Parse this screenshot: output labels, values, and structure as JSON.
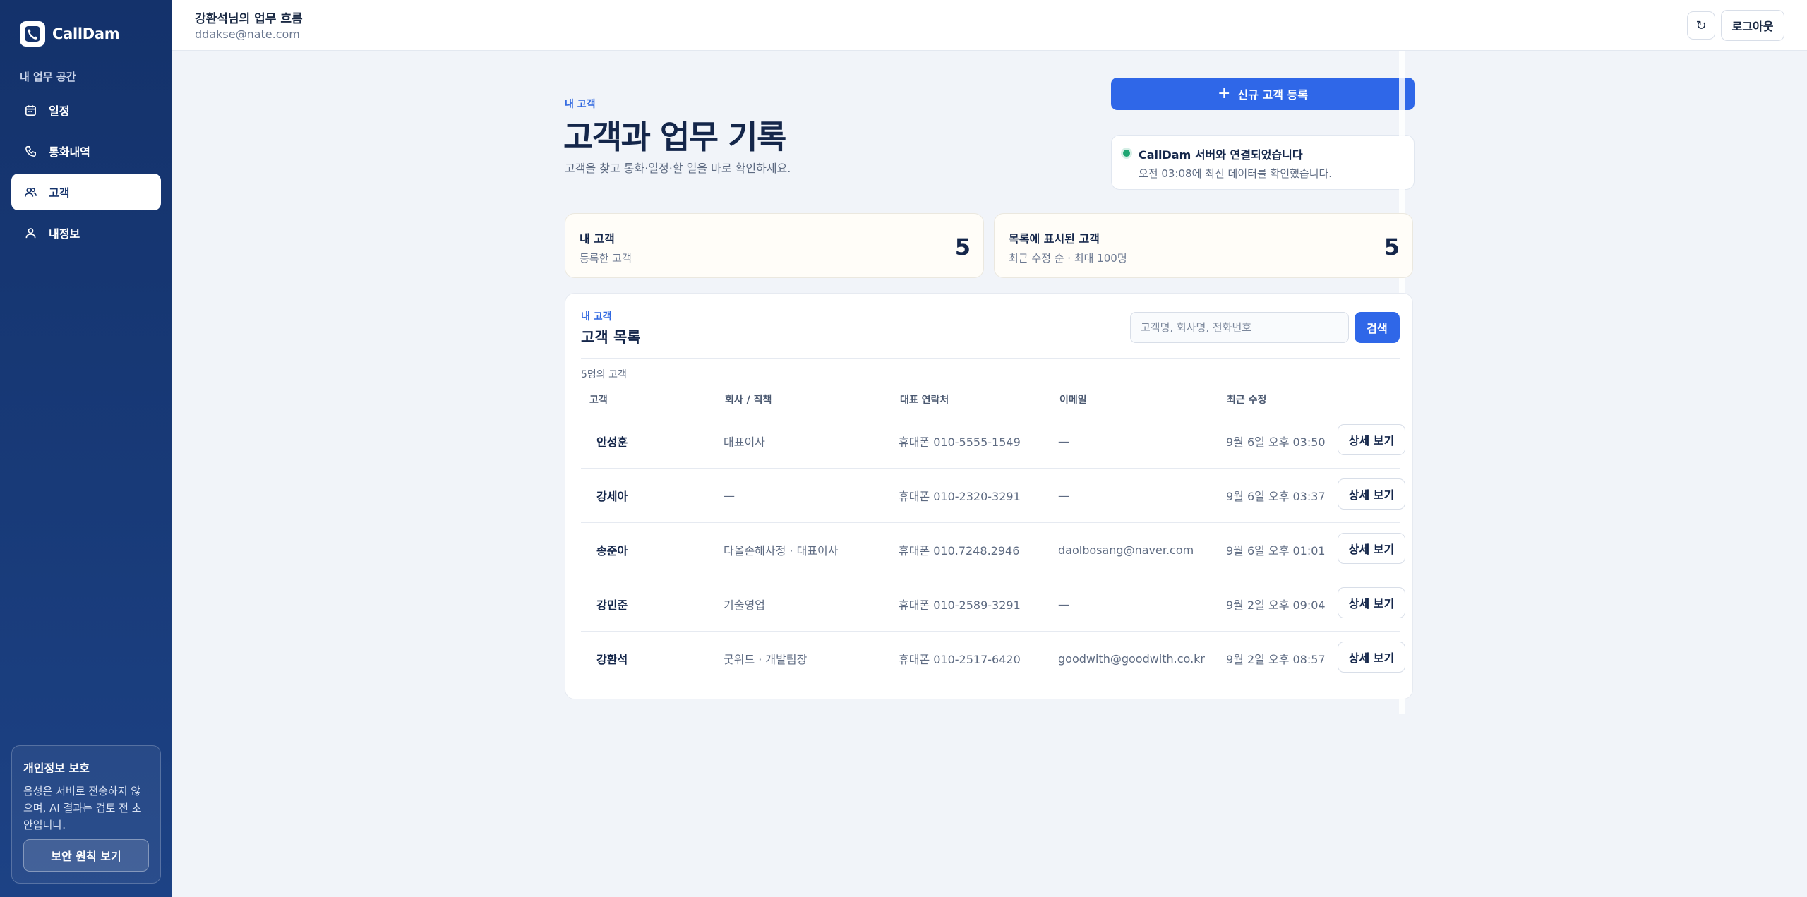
{
  "app": {
    "name": "CallDam"
  },
  "sidebar": {
    "section_label": "내 업무 공간",
    "items": [
      {
        "label": "일정",
        "icon": "calendar-icon",
        "active": false
      },
      {
        "label": "통화내역",
        "icon": "phone-icon",
        "active": false
      },
      {
        "label": "고객",
        "icon": "users-icon",
        "active": true
      },
      {
        "label": "내정보",
        "icon": "user-icon",
        "active": false
      }
    ],
    "privacy": {
      "title": "개인정보 보호",
      "text": "음성은 서버로 전송하지 않으며, AI 결과는 검토 전 초안입니다.",
      "button_label": "보안 원칙 보기"
    }
  },
  "header": {
    "title": "강환석님의 업무 흐름",
    "email": "ddakse@nate.com",
    "refresh_icon": "↻",
    "logout_label": "로그아웃"
  },
  "page": {
    "eyebrow": "내 고객",
    "title": "고객과 업무 기록",
    "subtitle": "고객을 찾고 통화·일정·할 일을 바로 확인하세요.",
    "new_button_label": "신규 고객 등록",
    "connection": {
      "title": "CallDam 서버와 연결되었습니다",
      "text": "오전 03:08에 최신 데이터를 확인했습니다."
    }
  },
  "stats": [
    {
      "label": "내 고객",
      "sub": "등록한 고객",
      "value": "5"
    },
    {
      "label": "목록에 표시된 고객",
      "sub": "최근 수정 순 · 최대 100명",
      "value": "5"
    }
  ],
  "customers": {
    "eyebrow": "내 고객",
    "title": "고객 목록",
    "search_placeholder": "고객명, 회사명, 전화번호",
    "search_button": "검색",
    "count_text": "5명의 고객",
    "columns": [
      "고객",
      "회사 / 직책",
      "대표 연락처",
      "이메일",
      "최근 수정"
    ],
    "detail_label": "상세 보기",
    "rows": [
      {
        "name": "안성훈",
        "company": "대표이사",
        "phone": "휴대폰 010-5555-1549",
        "email": "—",
        "updated": "9월 6일 오후 03:50"
      },
      {
        "name": "강세아",
        "company": "—",
        "phone": "휴대폰 010-2320-3291",
        "email": "—",
        "updated": "9월 6일 오후 03:37"
      },
      {
        "name": "송준아",
        "company": "다올손해사정 · 대표이사",
        "phone": "휴대폰 010.7248.2946",
        "email": "daolbosang@naver.com",
        "updated": "9월 6일 오후 01:01"
      },
      {
        "name": "강민준",
        "company": "기술영업",
        "phone": "휴대폰 010-2589-3291",
        "email": "—",
        "updated": "9월 2일 오후 09:04"
      },
      {
        "name": "강환석",
        "company": "굿위드 · 개발팀장",
        "phone": "휴대폰 010-2517-6420",
        "email": "goodwith@goodwith.co.kr",
        "updated": "9월 2일 오후 08:57"
      }
    ]
  },
  "colors": {
    "sidebar": "#14326b",
    "accent": "#2f67e8",
    "online": "#1ea672",
    "background": "#f1f4f9"
  }
}
